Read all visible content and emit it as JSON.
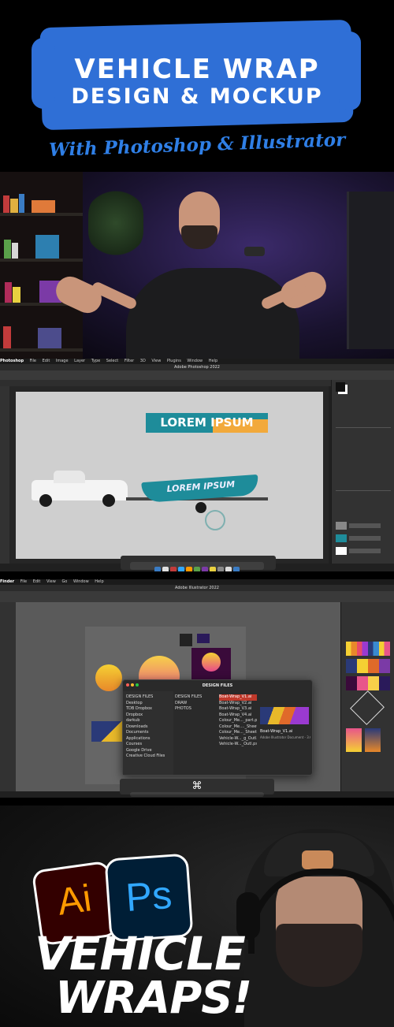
{
  "banner": {
    "title_line1": "VEHICLE WRAP",
    "title_line2": "DESIGN & MOCKUP",
    "subtitle": "With Photoshop & Illustrator",
    "brush_color": "#2F6FD6"
  },
  "photoshop": {
    "app_menu": [
      "Photoshop",
      "File",
      "Edit",
      "Image",
      "Layer",
      "Type",
      "Select",
      "Filter",
      "3D",
      "View",
      "Plugins",
      "Window",
      "Help"
    ],
    "window_title": "Adobe Photoshop 2022",
    "canvas_text": "LOREM IPSUM",
    "boat_text": "LOREM IPSUM",
    "colors": {
      "teal": "#1E8C9A",
      "orange": "#F2A93B"
    }
  },
  "illustrator": {
    "app_menu": [
      "Finder",
      "File",
      "Edit",
      "View",
      "Go",
      "Window",
      "Help"
    ],
    "window_title": "Adobe Illustrator 2022",
    "finder_title": "DESIGN FILES",
    "sidebar": [
      "DESIGN FILES",
      "Desktop",
      "TDB Dropbox",
      "Dropbox",
      "darkub",
      "Downloads",
      "Documents",
      "Applications",
      "Courses",
      "Google Drive",
      "Creative Cloud Files"
    ],
    "column1": [
      "DESIGN FILES",
      "DRAW",
      "PHOTOS"
    ],
    "column2": [
      "Boat-Wrap_V1.ai",
      "Boat-Wrap_V2.ai",
      "Boat-Wrap_V3.ai",
      "Boat-Wrap_V4.ai",
      "Colour_Me..._part.psd",
      "Colour_Me...._Sheet.psd",
      "Colour_Me..._Sheet.psd",
      "Vehicle-W..._g_Outl.psd",
      "Vehicle-W..._Outl.psd"
    ],
    "preview_name": "Boat-Wrap_V1.ai",
    "preview_meta": "Adobe Illustrator Document - 3.6 MB",
    "shortcut_glyph": "⌘"
  },
  "bottom": {
    "ai_label": "Ai",
    "ps_label": "Ps",
    "word1": "VEHICLE",
    "word2": "WRAPS!",
    "colors": {
      "ai_bg": "#330000",
      "ai_fg": "#FF9A00",
      "ps_bg": "#001E36",
      "ps_fg": "#31A8FF"
    }
  }
}
